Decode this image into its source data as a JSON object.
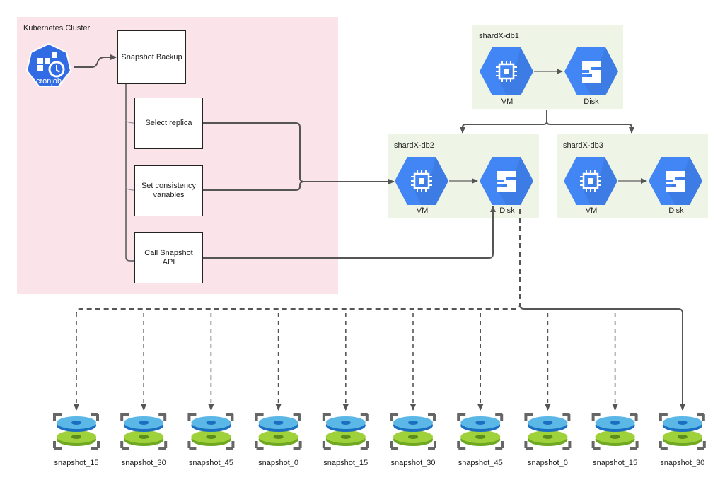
{
  "cluster": {
    "title": "Kubernetes Cluster",
    "color": "#fbe3ea",
    "cronjob_label": "cronjob",
    "steps": {
      "snapshot_backup": "Snapshot Backup",
      "select_replica": "Select replica",
      "set_consistency": "Set consistency variables",
      "call_snapshot_api": "Call Snapshot API"
    }
  },
  "shards": [
    {
      "title": "shardX-db1",
      "vm_label": "VM",
      "disk_label": "Disk"
    },
    {
      "title": "shardX-db2",
      "vm_label": "VM",
      "disk_label": "Disk"
    },
    {
      "title": "shardX-db3",
      "vm_label": "VM",
      "disk_label": "Disk"
    }
  ],
  "snapshots": [
    {
      "label": "snapshot_15",
      "link": "dashed"
    },
    {
      "label": "snapshot_30",
      "link": "dashed"
    },
    {
      "label": "snapshot_45",
      "link": "dashed"
    },
    {
      "label": "snapshot_0",
      "link": "dashed"
    },
    {
      "label": "snapshot_15",
      "link": "dashed"
    },
    {
      "label": "snapshot_30",
      "link": "dashed"
    },
    {
      "label": "snapshot_45",
      "link": "dashed"
    },
    {
      "label": "snapshot_0",
      "link": "dashed"
    },
    {
      "label": "snapshot_15",
      "link": "dashed"
    },
    {
      "label": "snapshot_30",
      "link": "solid"
    }
  ],
  "colors": {
    "gcp_blue": "#4285f4",
    "shard_bg": "#eff5e6",
    "line": "#555555",
    "disk_blue": "#3aa0dc",
    "disk_green": "#8cc63f"
  }
}
